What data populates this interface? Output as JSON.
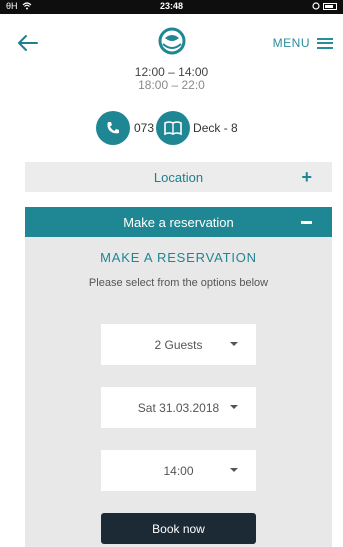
{
  "status_bar": {
    "carrier": "θH",
    "time": "23:48"
  },
  "header": {
    "menu_label": "MENU"
  },
  "hours": {
    "line1": "12:00 – 14:00",
    "line2": "18:00 – 22:0"
  },
  "contact": {
    "phone": "073",
    "deck": "Deck - 8"
  },
  "location": {
    "label": "Location",
    "toggle": "+"
  },
  "reservation": {
    "bar_label": "Make a reservation",
    "title": "MAKE A RESERVATION",
    "subtitle": "Please select from the options below",
    "guests": "2 Guests",
    "date": "Sat 31.03.2018",
    "time": "14:00",
    "book_label": "Book now"
  },
  "colors": {
    "accent": "#1f8694",
    "button_dark": "#1c2a36",
    "panel": "#e8e8e8"
  },
  "icons": [
    "back-arrow-icon",
    "restaurant-logo-icon",
    "hamburger-menu-icon",
    "phone-icon",
    "book-icon",
    "caret-down-icon"
  ]
}
